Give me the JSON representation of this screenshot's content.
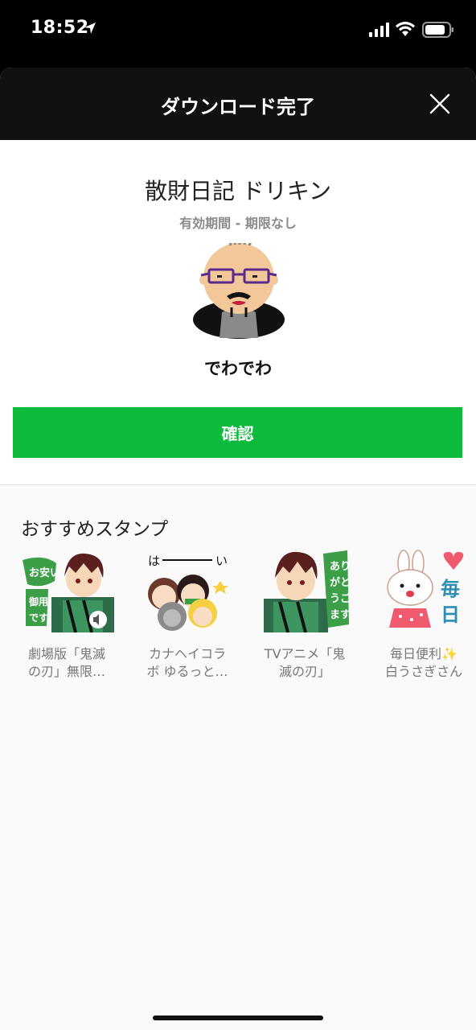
{
  "status": {
    "time": "18:52"
  },
  "header": {
    "title": "ダウンロード完了"
  },
  "product": {
    "name": "散財日記 ドリキン",
    "validity": "有効期間 - 期限なし",
    "author": "でわでわ"
  },
  "confirm": {
    "label": "確認"
  },
  "recommend": {
    "title": "おすすめスタンプ",
    "items": [
      {
        "line1": "劇場版「鬼滅",
        "line2": "の刃」無限…"
      },
      {
        "line1": "カナヘイコラ",
        "line2": "ボ ゆるっと…"
      },
      {
        "line1": "TVアニメ「鬼",
        "line2": "滅の刃」"
      },
      {
        "line1": "毎日便利✨",
        "line2": "白うさぎさん"
      }
    ]
  },
  "colors": {
    "accent": "#0cbb3c",
    "header": "#111111"
  }
}
